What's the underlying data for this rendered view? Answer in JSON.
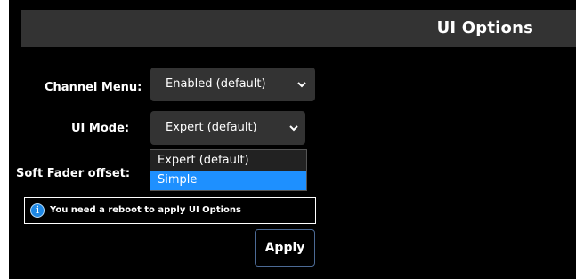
{
  "header": {
    "title": "UI Options"
  },
  "form": {
    "channel_menu": {
      "label": "Channel Menu:",
      "value": "Enabled (default)",
      "chevron_icon": "chevron-down-icon"
    },
    "ui_mode": {
      "label": "UI Mode:",
      "value": "Expert (default)",
      "chevron_icon": "chevron-down-icon",
      "options": [
        "Expert (default)",
        "Simple"
      ],
      "highlighted_option": "Simple"
    },
    "soft_fader_offset": {
      "label": "Soft Fader offset:"
    }
  },
  "notice": {
    "icon": "info-icon",
    "glyph": "i",
    "text": "You need a reboot to apply UI Options"
  },
  "actions": {
    "apply_label": "Apply"
  },
  "colors": {
    "background": "#000000",
    "header": "#333333",
    "select": "#333333",
    "highlight": "#1e90ff",
    "info_icon": "#1e88e5",
    "apply_border": "#4c6a95"
  }
}
